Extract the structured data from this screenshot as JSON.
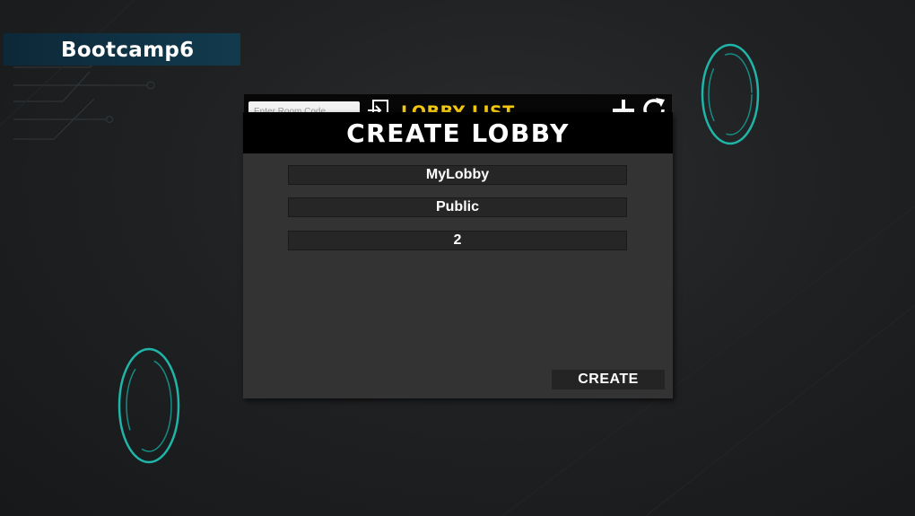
{
  "app": {
    "title": "Bootcamp6"
  },
  "lobby_list": {
    "title": "LOBBY LIST",
    "room_code_placeholder": "Enter Room Code..."
  },
  "create_lobby": {
    "title": "CREATE LOBBY",
    "lobby_name": "MyLobby",
    "visibility": "Public",
    "max_players": "2",
    "create_label": "CREATE"
  },
  "icons": [
    "join-icon",
    "plus-icon",
    "refresh-icon"
  ],
  "colors": {
    "accent_yellow": "#f2c811",
    "teal_ring": "#1fb5a8",
    "modal_bg": "#333333",
    "header_bg": "#000000",
    "title_bar_bg": "#0f3446"
  }
}
